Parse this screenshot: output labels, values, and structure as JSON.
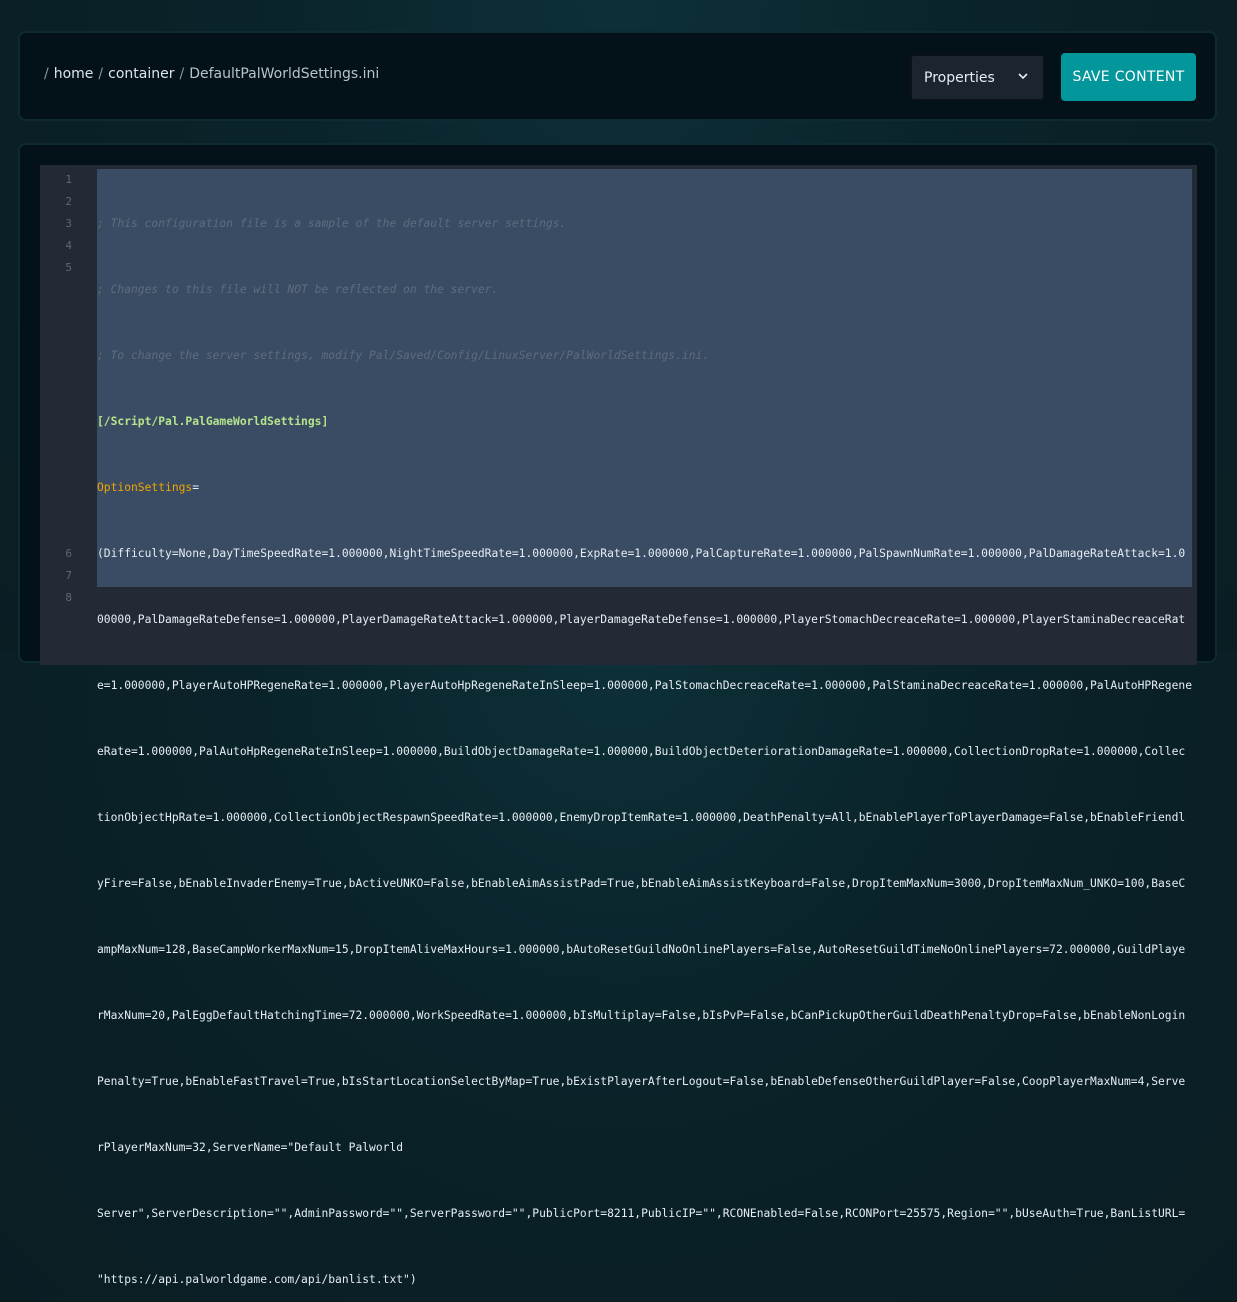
{
  "breadcrumb": {
    "root": "/",
    "segments": [
      "home",
      "container"
    ],
    "file": "DefaultPalWorldSettings.ini"
  },
  "toolbar": {
    "select_value": "Properties",
    "save_label": "SAVE CONTENT"
  },
  "colors": {
    "accent": "#03969b",
    "comment": "#5f6c7e",
    "section": "#b5e48c",
    "key": "#f0a500"
  },
  "editor": {
    "line_numbers": [
      "1",
      "2",
      "3",
      "4",
      "5",
      "6",
      "7",
      "8"
    ],
    "lines": [
      "; This configuration file is a sample of the default server settings.",
      "; Changes to this file will NOT be reflected on the server.",
      "; To change the server settings, modify Pal/Saved/Config/LinuxServer/PalWorldSettings.ini.",
      "[/Script/Pal.PalGameWorldSettings]",
      "OptionSettings",
      "=",
      "(Difficulty=None,DayTimeSpeedRate=1.000000,NightTimeSpeedRate=1.000000,ExpRate=1.000000,PalCaptureRate=1.000000,PalSpawnNumRate=1.000000,PalDamageRateAttack=1.0",
      "00000,PalDamageRateDefense=1.000000,PlayerDamageRateAttack=1.000000,PlayerDamageRateDefense=1.000000,PlayerStomachDecreaceRate=1.000000,PlayerStaminaDecreaceRat",
      "e=1.000000,PlayerAutoHPRegeneRate=1.000000,PlayerAutoHpRegeneRateInSleep=1.000000,PalStomachDecreaceRate=1.000000,PalStaminaDecreaceRate=1.000000,PalAutoHPRegene",
      "eRate=1.000000,PalAutoHpRegeneRateInSleep=1.000000,BuildObjectDamageRate=1.000000,BuildObjectDeteriorationDamageRate=1.000000,CollectionDropRate=1.000000,Collec",
      "tionObjectHpRate=1.000000,CollectionObjectRespawnSpeedRate=1.000000,EnemyDropItemRate=1.000000,DeathPenalty=All,bEnablePlayerToPlayerDamage=False,bEnableFriendl",
      "yFire=False,bEnableInvaderEnemy=True,bActiveUNKO=False,bEnableAimAssistPad=True,bEnableAimAssistKeyboard=False,DropItemMaxNum=3000,DropItemMaxNum_UNKO=100,BaseC",
      "ampMaxNum=128,BaseCampWorkerMaxNum=15,DropItemAliveMaxHours=1.000000,bAutoResetGuildNoOnlinePlayers=False,AutoResetGuildTimeNoOnlinePlayers=72.000000,GuildPlaye",
      "rMaxNum=20,PalEggDefaultHatchingTime=72.000000,WorkSpeedRate=1.000000,bIsMultiplay=False,bIsPvP=False,bCanPickupOtherGuildDeathPenaltyDrop=False,bEnableNonLogin",
      "Penalty=True,bEnableFastTravel=True,bIsStartLocationSelectByMap=True,bExistPlayerAfterLogout=False,bEnableDefenseOtherGuildPlayer=False,CoopPlayerMaxNum=4,Serve",
      "rPlayerMaxNum=32,ServerName=\"Default Palworld",
      "Server\",ServerDescription=\"\",AdminPassword=\"\",ServerPassword=\"\",PublicPort=8211,PublicIP=\"\",RCONEnabled=False,RCONPort=25575,Region=\"\",bUseAuth=True,BanListURL=",
      "\"https://api.palworldgame.com/api/banlist.txt\")"
    ]
  }
}
